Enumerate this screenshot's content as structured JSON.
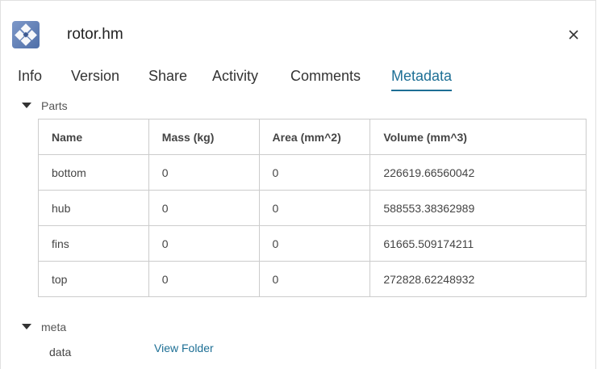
{
  "header": {
    "file_name": "rotor.hm",
    "file_icon": "hypermesh-file-icon",
    "close_icon": "close-icon"
  },
  "tabs": [
    {
      "label": "Info",
      "active": false
    },
    {
      "label": "Version",
      "active": false
    },
    {
      "label": "Share",
      "active": false
    },
    {
      "label": "Activity",
      "active": false
    },
    {
      "label": "Comments",
      "active": false
    },
    {
      "label": "Metadata",
      "active": true
    }
  ],
  "parts_section": {
    "title": "Parts",
    "columns": [
      "Name",
      "Mass (kg)",
      "Area (mm^2)",
      "Volume (mm^3)"
    ],
    "rows": [
      [
        "bottom",
        "0",
        "0",
        "226619.66560042"
      ],
      [
        "hub",
        "0",
        "0",
        "588553.38362989"
      ],
      [
        "fins",
        "0",
        "0",
        "61665.509174211"
      ],
      [
        "top",
        "0",
        "0",
        "272828.62248932"
      ]
    ]
  },
  "meta_section": {
    "title": "meta",
    "key": "data",
    "link_label": "View Folder"
  },
  "colors": {
    "accent": "#1d6f95",
    "border": "#cccccc",
    "text": "#333333"
  }
}
